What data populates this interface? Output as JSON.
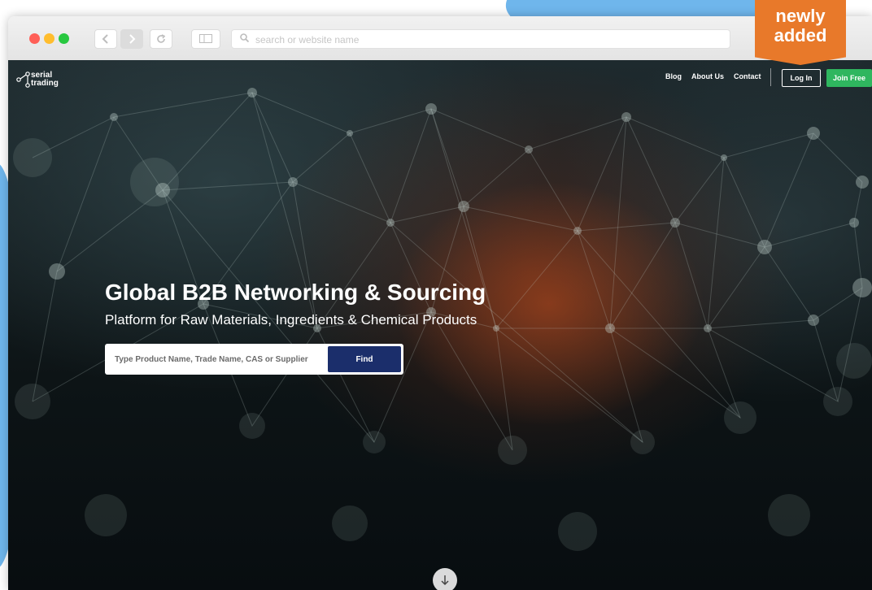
{
  "browser": {
    "address_placeholder": "search or website name",
    "back_icon": "chevron-left-icon",
    "forward_icon": "chevron-right-icon",
    "reload_icon": "reload-icon",
    "sidebar_icon": "sidebar-icon",
    "search_icon": "search-icon",
    "traffic_lights": [
      "#ff5f57",
      "#ffbd2e",
      "#28c840"
    ]
  },
  "badge": {
    "line1": "newly",
    "line2": "added",
    "color": "#e8792a"
  },
  "site": {
    "logo": {
      "line1": "serial",
      "line2": "trading"
    },
    "nav": {
      "blog": "Blog",
      "about": "About Us",
      "contact": "Contact",
      "login": "Log In",
      "join": "Join Free"
    },
    "hero": {
      "headline": "Global B2B Networking & Sourcing",
      "subheadline": "Platform for Raw Materials, Ingredients & Chemical Products",
      "search_placeholder": "Type Product Name, Trade Name, CAS or Supplier",
      "find_label": "Find",
      "scroll_icon": "arrow-down-icon"
    },
    "colors": {
      "join": "#2fb65f",
      "find": "#1b2e6b"
    }
  }
}
